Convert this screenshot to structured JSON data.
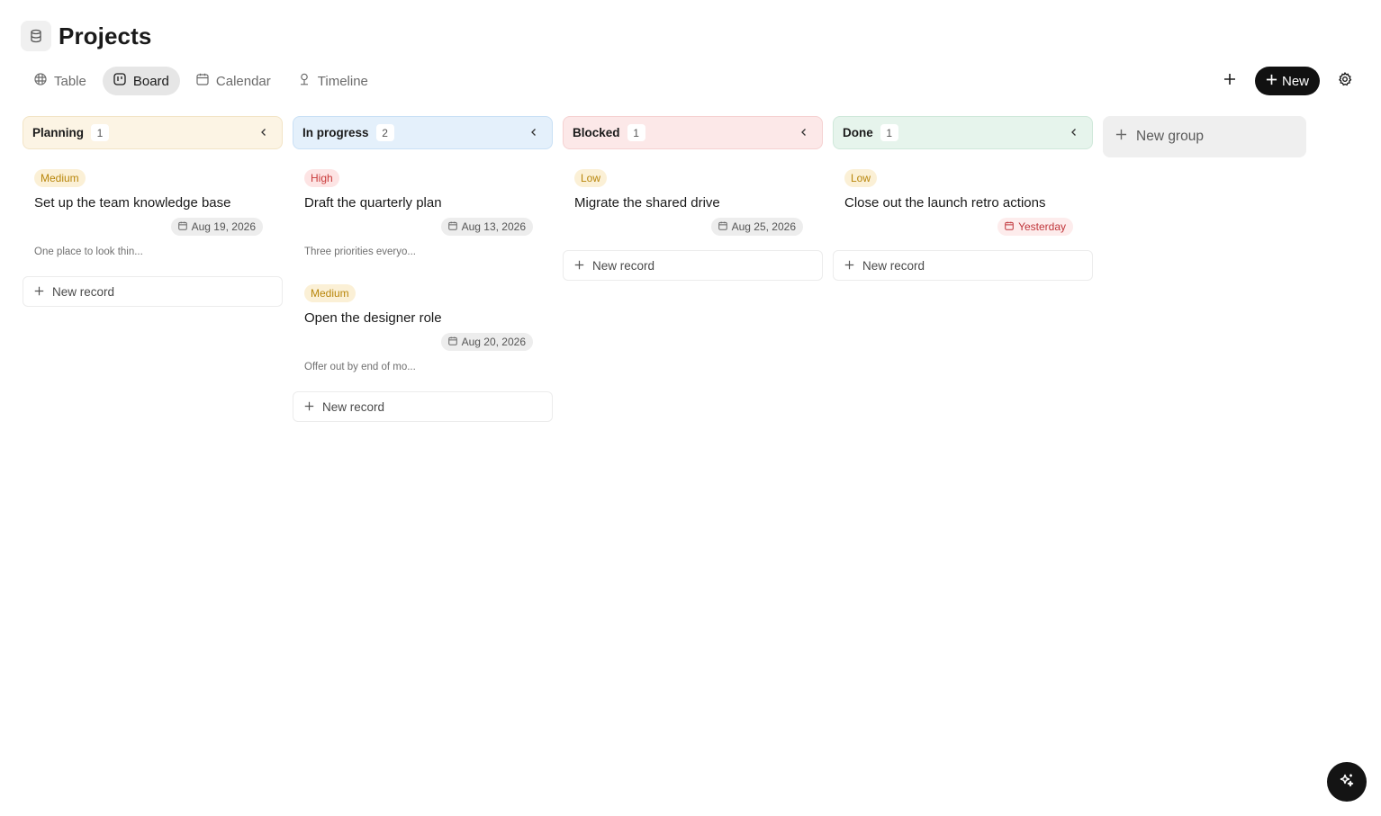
{
  "page": {
    "title": "Projects"
  },
  "tabs": [
    {
      "label": "Table",
      "icon": "table-icon",
      "active": false
    },
    {
      "label": "Board",
      "icon": "board-icon",
      "active": true
    },
    {
      "label": "Calendar",
      "icon": "calendar-icon",
      "active": false
    },
    {
      "label": "Timeline",
      "icon": "timeline-icon",
      "active": false
    }
  ],
  "toolbar": {
    "new_label": "New",
    "add_icon": "plus-icon",
    "settings_icon": "gear-icon"
  },
  "columns": [
    {
      "title": "Planning",
      "count": "1",
      "header_bg": "#fcf4e4",
      "header_border": "#f2e4c6",
      "cards": [
        {
          "priority": "Medium",
          "title": "Set up the team knowledge base",
          "date": "Aug 19, 2026",
          "description": "One place to look thin..."
        }
      ],
      "new_record_label": "New record"
    },
    {
      "title": "In progress",
      "count": "2",
      "header_bg": "#e4f0fb",
      "header_border": "#c9e0f5",
      "cards": [
        {
          "priority": "High",
          "title": "Draft the quarterly plan",
          "date": "Aug 13, 2026",
          "description": "Three priorities everyo..."
        },
        {
          "priority": "Medium",
          "title": "Open the designer role",
          "date": "Aug 20, 2026",
          "description": "Offer out by end of mo..."
        }
      ],
      "new_record_label": "New record"
    },
    {
      "title": "Blocked",
      "count": "1",
      "header_bg": "#fce8e8",
      "header_border": "#f5d1d1",
      "cards": [
        {
          "priority": "Low",
          "title": "Migrate the shared drive",
          "date": "Aug 25, 2026",
          "description": ""
        }
      ],
      "new_record_label": "New record"
    },
    {
      "title": "Done",
      "count": "1",
      "header_bg": "#e6f4ec",
      "header_border": "#cfe8da",
      "cards": [
        {
          "priority": "Low",
          "title": "Close out the launch retro actions",
          "date": "Yesterday",
          "date_overdue": true,
          "description": ""
        }
      ],
      "new_record_label": "New record"
    }
  ],
  "priority_colors": {
    "Medium": {
      "bg": "#fbf0d6",
      "fg": "#b8860b"
    },
    "High": {
      "bg": "#fde4e4",
      "fg": "#c93a3a"
    },
    "Low": {
      "bg": "#fbf0d6",
      "fg": "#b8860b"
    }
  },
  "new_group_label": "New group",
  "fab": {
    "icon": "sparkle-icon"
  }
}
